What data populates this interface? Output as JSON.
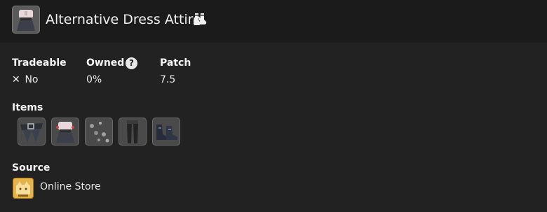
{
  "header": {
    "title": "Alternative Dress Attire",
    "icon": "dress-attire-icon",
    "title_icon": "socks-icon"
  },
  "stats": {
    "tradeable": {
      "label": "Tradeable",
      "value": "No",
      "icon": "x-icon"
    },
    "owned": {
      "label": "Owned",
      "value": "0%",
      "icon": "help-icon"
    },
    "patch": {
      "label": "Patch",
      "value": "7.5"
    }
  },
  "items": {
    "label": "Items",
    "list": [
      {
        "icon": "belt-icon"
      },
      {
        "icon": "dress-attire-icon"
      },
      {
        "icon": "earrings-icon"
      },
      {
        "icon": "leggings-icon"
      },
      {
        "icon": "boots-icon"
      }
    ]
  },
  "source": {
    "label": "Source",
    "icon": "online-store-icon",
    "value": "Online Store",
    "icon_color": "#e6b24a"
  },
  "colors": {
    "background": "#222222",
    "header_background": "#1b1b1b"
  }
}
